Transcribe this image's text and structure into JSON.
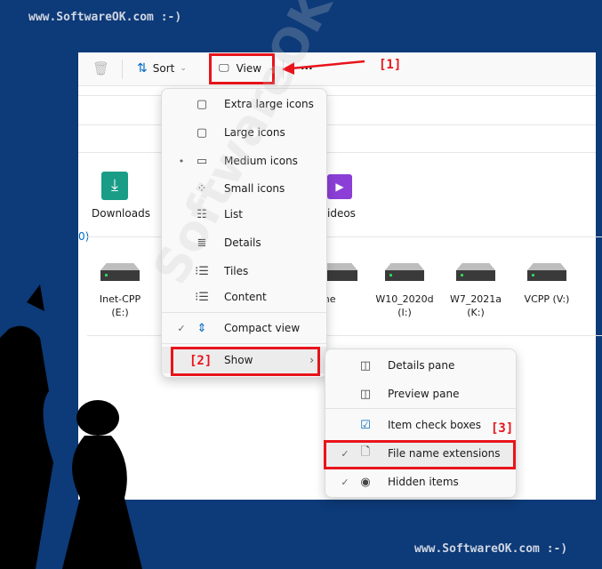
{
  "watermark_top": "www.SoftwareOK.com :-)",
  "watermark_bottom": "www.SoftwareOK.com :-)",
  "watermark_diagonal": "SoftwareOK.com",
  "toolbar": {
    "sort": "Sort",
    "view": "View",
    "more": "..."
  },
  "annotations": {
    "a1": "[1]",
    "a2": "[2]",
    "a3": "[3]"
  },
  "content": {
    "downloads": "Downloads",
    "videos": "ideos",
    "section_suffix": "0)",
    "drives": [
      {
        "l1": "Inet-CPP",
        "l2": "(E:)"
      },
      {
        "l1": "lume",
        "l2": "H:)"
      },
      {
        "l1": "W10_2020d",
        "l2": "(I:)"
      },
      {
        "l1": "W7_2021a",
        "l2": "(K:)"
      },
      {
        "l1": "VCPP (V:)",
        "l2": ""
      }
    ]
  },
  "view_menu": {
    "items": [
      {
        "label": "Extra large icons",
        "icon": "monitor-icon",
        "check": ""
      },
      {
        "label": "Large icons",
        "icon": "monitor-icon",
        "check": ""
      },
      {
        "label": "Medium icons",
        "icon": "monitor-icon",
        "check": "•"
      },
      {
        "label": "Small icons",
        "icon": "grid-icon",
        "check": ""
      },
      {
        "label": "List",
        "icon": "list-icon",
        "check": ""
      },
      {
        "label": "Details",
        "icon": "details-icon",
        "check": ""
      },
      {
        "label": "Tiles",
        "icon": "tiles-icon",
        "check": ""
      },
      {
        "label": "Content",
        "icon": "content-icon",
        "check": ""
      },
      {
        "label": "Compact view",
        "icon": "compact-icon",
        "check": "✓"
      },
      {
        "label": "Show",
        "icon": "",
        "check": ""
      }
    ]
  },
  "show_menu": {
    "items": [
      {
        "label": "Details pane",
        "icon": "details-pane-icon",
        "check": ""
      },
      {
        "label": "Preview pane",
        "icon": "preview-pane-icon",
        "check": ""
      },
      {
        "label": "Item check boxes",
        "icon": "checkbox-icon",
        "check": ""
      },
      {
        "label": "File name extensions",
        "icon": "file-icon",
        "check": "✓"
      },
      {
        "label": "Hidden items",
        "icon": "eye-icon",
        "check": "✓"
      }
    ]
  },
  "colors": {
    "background": "#0d3a78",
    "highlight": "#e8141b",
    "accent": "#0067c0"
  }
}
